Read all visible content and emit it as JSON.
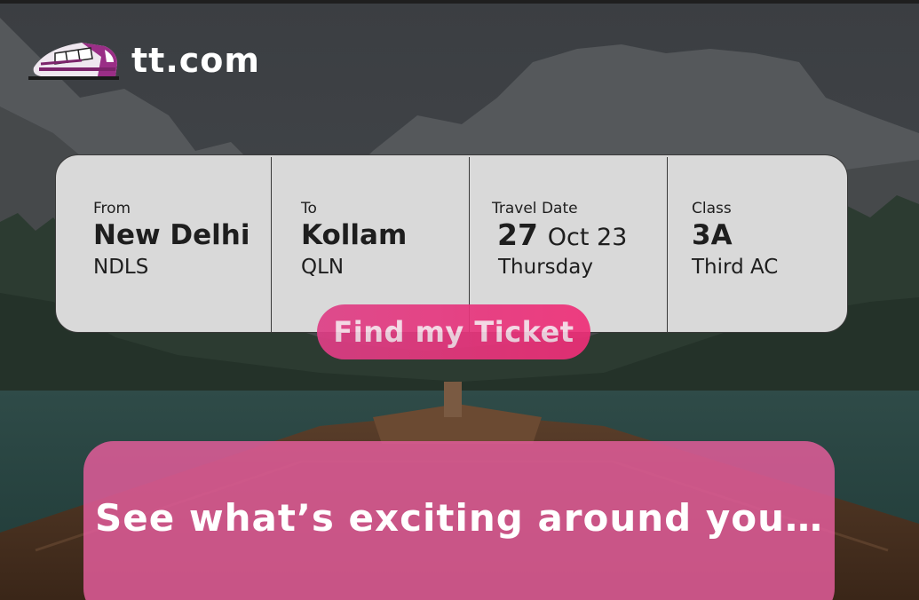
{
  "brand": {
    "name": "tt.com",
    "icon": "train-icon"
  },
  "search": {
    "from": {
      "label": "From",
      "city": "New Delhi",
      "code": "NDLS"
    },
    "to": {
      "label": "To",
      "city": "Kollam",
      "code": "QLN"
    },
    "travel_date": {
      "label": "Travel Date",
      "day": "27",
      "month_year": "Oct 23",
      "weekday": "Thursday"
    },
    "class": {
      "label": "Class",
      "code": "3A",
      "name": "Third AC"
    }
  },
  "find_button": {
    "label": "Find my Ticket"
  },
  "promo": {
    "text": "See what’s exciting around you…"
  },
  "colors": {
    "accent": "#e8357c",
    "promo_bg": "#df5c98",
    "card_bg": "#d9d9d9"
  }
}
